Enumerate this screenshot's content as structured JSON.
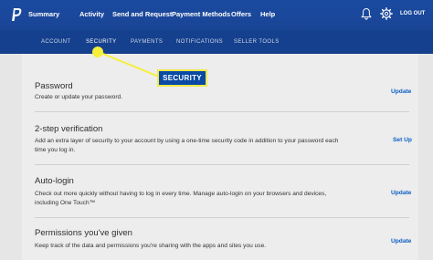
{
  "topnav": {
    "items": [
      "Summary",
      "Activity",
      "Send and Request",
      "Payment Methods",
      "Offers",
      "Help"
    ],
    "logout": "LOG OUT"
  },
  "subnav": {
    "items": [
      "ACCOUNT",
      "SECURITY",
      "PAYMENTS",
      "NOTIFICATIONS",
      "SELLER TOOLS"
    ],
    "active": "SECURITY"
  },
  "callout": {
    "label": "SECURITY"
  },
  "rows": [
    {
      "title": "Password",
      "desc": "Create or update your password.",
      "action": "Update"
    },
    {
      "title": "2-step verification",
      "desc": "Add an extra layer of security to your account by using a one-time security code in addition to your password each time you log in.",
      "action": "Set Up"
    },
    {
      "title": "Auto-login",
      "desc": "Check out more quickly without having to log in every time. Manage auto-login on your browsers and devices, including One Touch™",
      "action": "Update"
    },
    {
      "title": "Permissions you've given",
      "desc": "Keep track of the data and permissions you're sharing with the apps and sites you use.",
      "action": "Update"
    }
  ],
  "colors": {
    "topbar": "#1a4aa0",
    "subbar": "#15408d",
    "link": "#0b5ec4",
    "callout_bg": "#0a4aa4",
    "callout_border": "#f1e84a",
    "highlight": "#f6ef3a"
  },
  "icons": [
    "paypal-logo-icon",
    "bell-icon",
    "gear-icon"
  ]
}
